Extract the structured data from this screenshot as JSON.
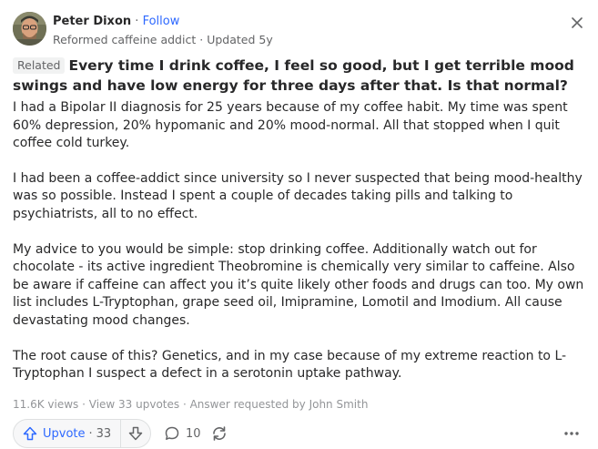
{
  "author": {
    "name": "Peter Dixon",
    "separator": "·",
    "follow_label": "Follow",
    "credential": "Reformed caffeine addict",
    "updated": "Updated 5y"
  },
  "question": {
    "tag": "Related",
    "text": "Every time I drink coffee, I feel so good, but I get terrible mood swings and have low energy for three days after that. Is that normal?"
  },
  "answer": {
    "paragraphs": [
      "I had a Bipolar II diagnosis for 25 years because of my coffee habit. My time was spent 60% depression, 20% hypomanic and 20% mood-normal. All that stopped when I quit coffee cold turkey.",
      "I had been a coffee-addict since university so I never suspected that being mood-healthy was so possible. Instead I spent a couple of decades taking pills and talking to psychiatrists, all to no effect.",
      "My advice to you would be simple: stop drinking coffee. Additionally watch out for chocolate - its active ingredient Theobromine is chemically very similar to caffeine. Also be aware if caffeine can affect you it’s quite likely other foods and drugs can too. My own list includes L-Tryptophan, grape seed oil, Imipramine, Lomotil and Imodium. All cause devastating mood changes.",
      "The root cause of this? Genetics, and in my case because of my extreme reaction to L-Tryptophan I suspect a defect in a serotonin uptake pathway."
    ]
  },
  "meta": {
    "views": "11.6K views",
    "upvotes_link": "View 33 upvotes",
    "requested": "Answer requested by John Smith",
    "separator": " · "
  },
  "actions": {
    "upvote_label": "Upvote",
    "upvote_sep": "·",
    "upvote_count": "33",
    "comment_count": "10"
  },
  "icons": {
    "close": "close-icon",
    "upvote": "arrow-up-icon",
    "downvote": "arrow-down-icon",
    "comment": "comment-bubble-icon",
    "share": "share-recycle-icon",
    "more": "more-horizontal-icon"
  },
  "colors": {
    "accent": "#2e69ff",
    "text": "#282829",
    "muted": "#636466",
    "meta": "#939598"
  }
}
